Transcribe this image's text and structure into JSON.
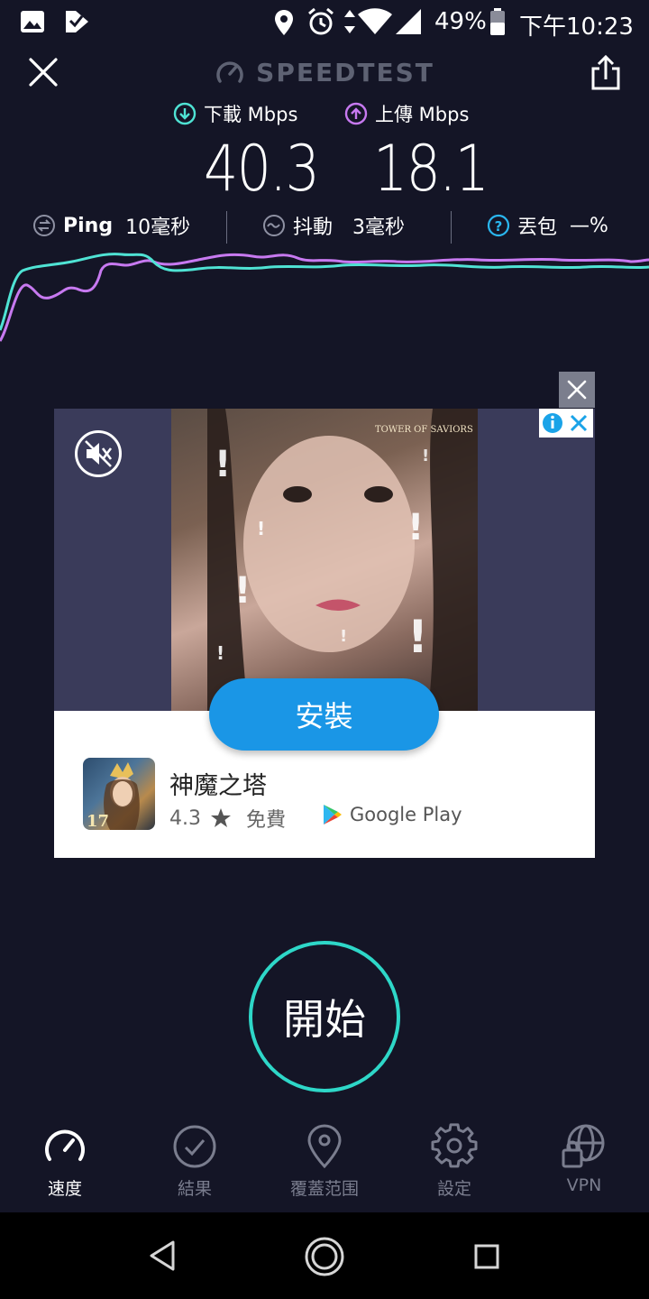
{
  "status_bar": {
    "battery": "49%",
    "time": "下午10:23",
    "icons": [
      "image-icon",
      "app-notification-icon",
      "location-icon",
      "alarm-icon",
      "data-arrows-icon",
      "wifi-icon",
      "signal-icon",
      "battery-icon"
    ]
  },
  "header": {
    "title": "SPEEDTEST",
    "close_icon": "close-icon",
    "share_icon": "share-icon"
  },
  "metrics": {
    "download": {
      "label": "下載 Mbps",
      "value": "40.3",
      "color": "#4fe3d4"
    },
    "upload": {
      "label": "上傳 Mbps",
      "value": "18.1",
      "color": "#c779f0"
    }
  },
  "stats": {
    "ping": {
      "label": "Ping",
      "value": "10毫秒"
    },
    "jitter": {
      "label": "抖動",
      "value": "3毫秒"
    },
    "loss": {
      "label": "丟包",
      "value": "—%"
    }
  },
  "ad": {
    "install_label": "安裝",
    "app_name": "神魔之塔",
    "rating": "4.3",
    "price": "免費",
    "store": "Google Play",
    "overlay_text": "TOWER OF SAVIORS"
  },
  "go_button": {
    "label": "開始"
  },
  "nav": {
    "items": [
      {
        "label": "速度",
        "icon": "speedometer-icon",
        "active": true
      },
      {
        "label": "結果",
        "icon": "check-circle-icon",
        "active": false
      },
      {
        "label": "覆蓋范围",
        "icon": "map-pin-icon",
        "active": false
      },
      {
        "label": "設定",
        "icon": "gear-icon",
        "active": false
      },
      {
        "label": "VPN",
        "icon": "vpn-globe-lock-icon",
        "active": false
      }
    ]
  },
  "colors": {
    "background": "#141526",
    "accent_teal": "#2ed7c8",
    "download": "#4fe3d4",
    "upload": "#c779f0",
    "install": "#1a96e6"
  }
}
